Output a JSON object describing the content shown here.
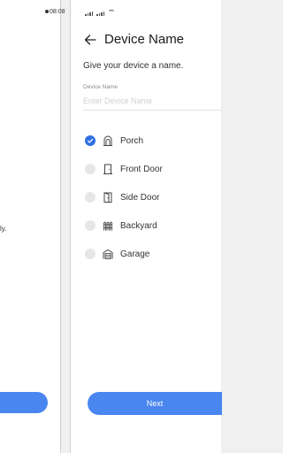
{
  "left_panel": {
    "time": "08:08",
    "partial_text": "ly.",
    "button_label": ""
  },
  "status_bar": {
    "signal_icon": "cellular-signal-icon",
    "wifi_icon": "wifi-icon"
  },
  "header": {
    "back_icon": "arrow-left-icon",
    "title": "Device Name"
  },
  "subtitle": "Give your device a name.",
  "field": {
    "label": "Device Name",
    "value": "",
    "placeholder": "Enter Device Name"
  },
  "options": [
    {
      "label": "Porch",
      "icon": "porch-arch-icon",
      "selected": true
    },
    {
      "label": "Front Door",
      "icon": "front-door-icon",
      "selected": false
    },
    {
      "label": "Side Door",
      "icon": "side-door-icon",
      "selected": false
    },
    {
      "label": "Backyard",
      "icon": "fence-icon",
      "selected": false
    },
    {
      "label": "Garage",
      "icon": "garage-icon",
      "selected": false
    }
  ],
  "next_button": {
    "label": "Next"
  },
  "colors": {
    "accent": "#4a86f0",
    "radio_selected": "#2f6fe4",
    "radio_unselected": "#e6e6e6"
  }
}
